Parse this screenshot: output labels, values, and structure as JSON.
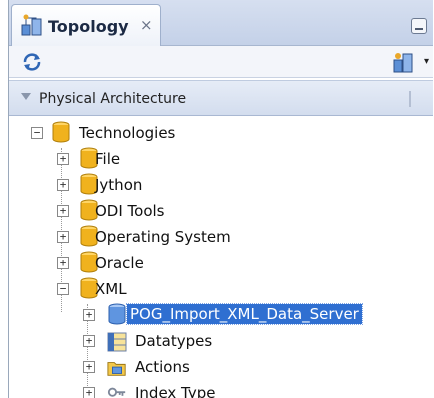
{
  "tab": {
    "title": "Topology",
    "close_label": "×"
  },
  "accordion": {
    "title": "Physical Architecture"
  },
  "tree": {
    "root": {
      "label": "Technologies",
      "toggle": "−"
    },
    "technologies": [
      {
        "label": "File",
        "toggle": "+"
      },
      {
        "label": "Jython",
        "toggle": "+"
      },
      {
        "label": "ODI Tools",
        "toggle": "+"
      },
      {
        "label": "Operating System",
        "toggle": "+"
      },
      {
        "label": "Oracle",
        "toggle": "+"
      },
      {
        "label": "XML",
        "toggle": "−"
      }
    ],
    "xml_children": [
      {
        "label": "POG_Import_XML_Data_Server",
        "toggle": "+",
        "selected": true,
        "icon": "data-server-icon"
      },
      {
        "label": "Datatypes",
        "toggle": "+",
        "icon": "datatypes-icon"
      },
      {
        "label": "Actions",
        "toggle": "+",
        "icon": "actions-folder-icon"
      },
      {
        "label": "Index Type",
        "toggle": "+",
        "icon": "index-type-icon"
      }
    ]
  },
  "colors": {
    "selection": "#2f6fd1",
    "folder_gold": "#f0b21e",
    "header_bg": "#d3ddee"
  }
}
